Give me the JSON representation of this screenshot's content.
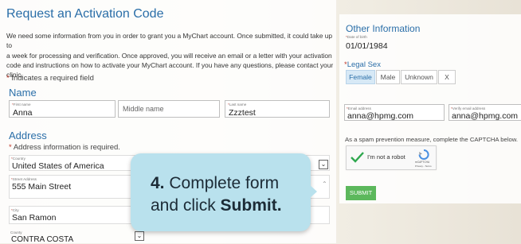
{
  "title": "Request an Activation Code",
  "intro": {
    "line1": "We need some information from you in order to grant you a MyChart account. Once submitted, it could take up to",
    "line2": "a week for processing and verification. Once approved, you will receive an email or a letter with your activation",
    "line3": "code and instructions on how to activate your MyChart account. If you have any questions, please contact your",
    "line4": "clinic."
  },
  "required_note": "Indicates a required field",
  "name_section": {
    "heading": "Name",
    "first_name_label": "First name",
    "first_name_value": "Anna",
    "middle_name_placeholder": "Middle name",
    "last_name_label": "Last name",
    "last_name_value": "Zzztest"
  },
  "address_section": {
    "heading": "Address",
    "required_note": "Address information is required.",
    "country_label": "Country",
    "country_value": "United States of America",
    "street_label": "Street Address",
    "street_value": "555 Main Street",
    "city_label": "City",
    "city_value": "San Ramon",
    "county_label": "County",
    "county_value": "CONTRA COSTA"
  },
  "other_info": {
    "heading": "Other Information",
    "dob_label": "Date of birth",
    "dob_value": "01/01/1984",
    "legal_sex_label": "Legal Sex",
    "legal_sex_options": [
      "Female",
      "Male",
      "Unknown",
      "X"
    ],
    "selected_sex": "Female",
    "email_label": "Email address",
    "email_value": "anna@hpmg.com",
    "verify_email_label": "Verify email address",
    "verify_email_value": "anna@hpmg.com",
    "captcha_note": "As a spam prevention measure, complete the CAPTCHA below.",
    "captcha_label": "I'm not a robot",
    "captcha_brand": "reCAPTCHA",
    "captcha_links": "Privacy - Terms",
    "submit_label": "SUBMIT"
  },
  "callout": {
    "step": "4.",
    "text1": " Complete form",
    "text2a": "and click ",
    "text2b": "Submit."
  },
  "colors": {
    "heading": "#2a6ea8",
    "required": "#c0392b",
    "submit": "#5cb85c",
    "callout": "#b9e1ed",
    "checkmark": "#2fa84f"
  }
}
